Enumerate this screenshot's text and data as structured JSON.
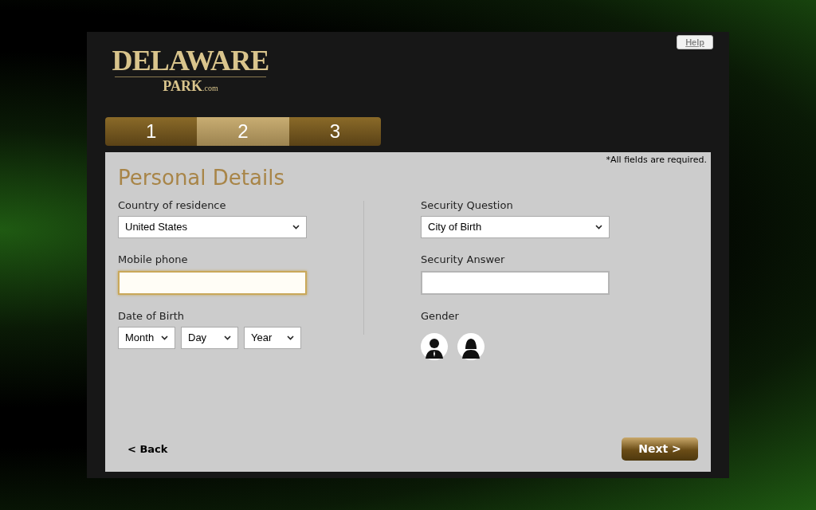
{
  "header": {
    "logo": {
      "name": "DELAWARE",
      "sub": "PARK",
      "suffix": ".com"
    },
    "help": "Help"
  },
  "steps": [
    {
      "label": "1",
      "selected": false
    },
    {
      "label": "2",
      "selected": true
    },
    {
      "label": "3",
      "selected": false
    }
  ],
  "form": {
    "title": "Personal Details",
    "required_note": "*All fields are required.",
    "left": [
      {
        "kind": "select",
        "label": "Country of residence",
        "value": "United States"
      },
      {
        "kind": "input",
        "label": "Mobile phone",
        "focused": true
      },
      {
        "kind": "date",
        "label": "Date of Birth",
        "parts": [
          "Month",
          "Day",
          "Year"
        ]
      }
    ],
    "right": [
      {
        "kind": "select",
        "label": "Security Question",
        "value": "City of Birth"
      },
      {
        "kind": "input",
        "label": "Security Answer",
        "focused": false
      },
      {
        "kind": "gender",
        "label": "Gender",
        "options": [
          {
            "kind": "male",
            "selected": false
          },
          {
            "kind": "female",
            "selected": false
          }
        ]
      }
    ],
    "back": "< Back",
    "next": "Next >"
  }
}
